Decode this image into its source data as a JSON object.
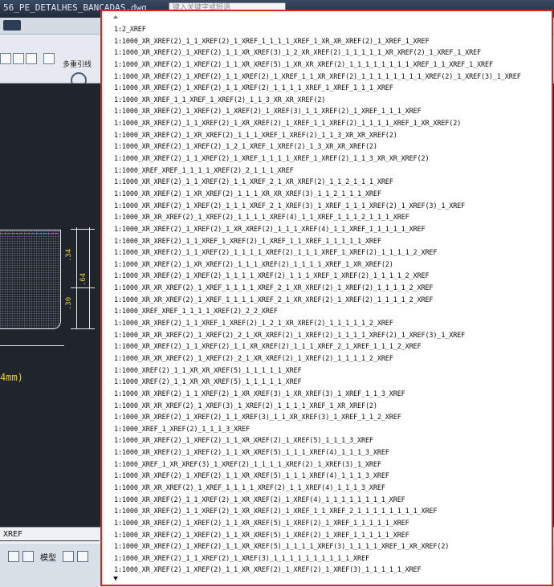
{
  "window": {
    "title": "56_PE_DETALHES_BANCADAS.dwg",
    "search_placeholder": "键入关键字或短语"
  },
  "ribbon": {
    "multileader_label": "多重引线"
  },
  "drawing": {
    "dim_top": ".34",
    "dim_mid": ".64",
    "dim_bottom": ".30",
    "unit_text": "4mm)"
  },
  "command_line": {
    "value": "XREF"
  },
  "status_bar": {
    "model_label": "模型"
  },
  "layer_list": {
    "items": [
      "1:2_XREF",
      "1:1000_XR_XREF(2)_1_1_XREF(2)_1_XREF_1_1_1_1_XREF_1_XR_XR_XREF(2)_1_XREF_1_XREF",
      "1:1000_XR_XREF(2)_1_XREF(2)_1_1_XR_XREF(3)_1_2_XR_XREF(2)_1_1_1_1_1_XR_XREF(2)_1_XREF_1_XREF",
      "1:1000_XR_XREF(2)_1_XREF(2)_1_1_XR_XREF(5)_1_XR_XR_XREF(2)_1_1_1_1_1_1_1_1_XREF_1_1_XREF_1_XREF",
      "1:1000_XR_XREF(2)_1_XREF(2)_1_1_XREF(2)_1_XREF_1_1_XR_XREF(2)_1_1_1_1_1_1_1_1_XREF(2)_1_XREF(3)_1_XREF",
      "1:1000_XR_XREF(2)_1_XREF(2)_1_1_XREF(2)_1_1_1_1_XREF_1_XREF_1_1_1_XREF",
      "1:1000_XR_XREF_1_1_XREF_1_XREF(2)_1_1_3_XR_XR_XREF(2)",
      "1:1000_XR_XREF(2)_1_XREF(2)_1_XREF(2)_1_XREF(3)_1_1_XREF(2)_1_XREF_1_1_1_XREF",
      "1:1000_XR_XREF(2)_1_1_XREF(2)_1_XR_XREF(2)_1_XREF_1_1_XREF(2)_1_1_1_1_XREF_1_XR_XREF(2)",
      "1:1000_XR_XREF(2)_1_XR_XREF(2)_1_1_1_XREF_1_XREF(2)_1_1_3_XR_XR_XREF(2)",
      "1:1000_XR_XREF(2)_1_XREF(2)_1_2_1_XREF_1_XREF(2)_1_3_XR_XR_XREF(2)",
      "1:1000_XR_XREF(2)_1_1_XREF(2)_1_XREF_1_1_1_1_XREF_1_XREF(2)_1_1_3_XR_XR_XREF(2)",
      "1:1000_XREF_XREF_1_1_1_1_XREF(2)_2_1_1_1_XREF",
      "1:1000_XR_XREF(2)_1_1_XREF(2)_1_1_XREF_2_1_XR_XREF(2)_1_1_2_1_1_1_XREF",
      "1:1000_XR_XREF(2)_1_XR_XREF(2)_1_1_1_XR_XR_XREF(3)_1_1_2_1_1_1_XREF",
      "1:1000_XR_XREF(2)_1_XREF(2)_1_1_1_XREF_2_1_XREF(3)_1_XREF_1_1_1_XREF(2)_1_XREF(3)_1_XREF",
      "1:1000_XR_XR_XREF(2)_1_XREF(2)_1_1_1_1_XREF(4)_1_1_XREF_1_1_1_2_1_1_1_XREF",
      "1:1000_XR_XREF(2)_1_XREF(2)_1_XR_XREF(2)_1_1_1_XREF(4)_1_1_XREF_1_1_1_1_1_XREF",
      "1:1000_XR_XREF(2)_1_1_XREF_1_XREF(2)_1_XREF_1_1_XREF_1_1_1_1_1_XREF",
      "1:1000_XR_XREF(2)_1_1_XREF(2)_1_1_1_1_XREF(2)_1_1_1_XREF_1_XREF(2)_1_1_1_1_2_XREF",
      "1:1000_XR_XREF(2)_1_XR_XREF(2)_1_1_1_XREF(2)_1_1_1_1_XREF_1_XR_XREF(2)",
      "1:1000_XR_XREF(2)_1_XREF(2)_1_1_1_1_XREF(2)_1_1_1_XREF_1_XREF(2)_1_1_1_1_2_XREF",
      "1:1000_XR_XR_XREF(2)_1_XREF_1_1_1_1_XREF_2_1_XR_XREF(2)_1_XREF(2)_1_1_1_1_2_XREF",
      "1:1000_XR_XR_XREF(2)_1_XREF_1_1_1_1_XREF_2_1_XR_XREF(2)_1_XREF(2)_1_1_1_1_2_XREF",
      "1:1000_XREF_XREF_1_1_1_1_XREF(2)_2_2_XREF",
      "1:1000_XR_XREF(2)_1_1_XREF_1_XREF(2)_1_2_1_XR_XREF(2)_1_1_1_1_1_2_XREF",
      "1:1000_XR_XR_XREF(2)_1_XREF(2)_2_1_XR_XREF(2)_1_XREF(2)_1_1_1_1_XREF(2)_1_XREF(3)_1_XREF",
      "1:1000_XR_XREF(2)_1_1_XREF(2)_1_1_XR_XREF(2)_1_1_1_XREF_2_1_XREF_1_1_1_2_XREF",
      "1:1000_XR_XR_XREF(2)_1_XREF(2)_2_1_XR_XREF(2)_1_XREF(2)_1_1_1_1_2_XREF",
      "1:1000_XREF(2)_1_1_XR_XR_XREF(5)_1_1_1_1_1_XREF",
      "1:1000_XREF(2)_1_1_XR_XR_XREF(5)_1_1_1_1_1_XREF",
      "1:1000_XR_XREF(2)_1_1_XREF(2)_1_XR_XREF(3)_1_XR_XREF(3)_1_XREF_1_1_3_XREF",
      "1:1000_XR_XR_XREF(2)_1_XREF(3)_1_XREF(2)_1_1_1_1_XREF_1_XR_XREF(2)",
      "1:1000_XR_XREF(2)_1_XREF(2)_1_1_XREF(3)_1_1_XR_XREF(3)_1_XREF_1_1_2_XREF",
      "1:1000_XREF_1_XREF(2)_1_1_1_3_XREF",
      "1:1000_XR_XREF(2)_1_XREF(2)_1_1_XR_XREF(2)_1_XREF(5)_1_1_1_3_XREF",
      "1:1000_XR_XREF(2)_1_XREF(2)_1_1_XR_XREF(5)_1_1_1_XREF(4)_1_1_1_3_XREF",
      "1:1000_XREF_1_XR_XREF(3)_1_XREF(2)_1_1_1_1_XREF(2)_1_XREF(3)_1_XREF",
      "1:1000_XR_XREF(2)_1_XREF(2)_1_1_XR_XREF(5)_1_1_1_XREF(4)_1_1_1_3_XREF",
      "1:1000_XR_XR_XREF(2)_1_XREF_1_1_1_1_XREF(2)_1_1_XREF(4)_1_1_1_3_XREF",
      "1:1000_XR_XREF(2)_1_1_XREF(2)_1_XR_XREF(2)_1_XREF(4)_1_1_1_1_1_1_1_1_XREF",
      "1:1000_XR_XREF(2)_1_1_XREF(2)_1_XR_XREF(2)_1_XREF_1_1_XREF_2_1_1_1_1_1_1_1_1_XREF",
      "1:1000_XR_XREF(2)_1_XREF(2)_1_1_XR_XREF(5)_1_XREF(2)_1_XREF_1_1_1_1_1_XREF",
      "1:1000_XR_XREF(2)_1_XREF(2)_1_1_XR_XREF(5)_1_XREF(2)_1_XREF_1_1_1_1_1_XREF",
      "1:1000_XR_XREF(2)_1_XREF(2)_1_1_XR_XREF(5)_1_1_1_1_XREF(3)_1_1_1_1_XREF_1_XR_XREF(2)",
      "1:1000_XR_XREF(2)_1_1_XREF(2)_1_XREF(3)_1_1_1_1_1_1_1_1_1_1_XREF",
      "1:1000_XR_XREF(2)_1_XREF(2)_1_1_XR_XREF(2)_1_XREF(2)_1_XREF(3)_1_1_1_1_1_XREF"
    ]
  }
}
